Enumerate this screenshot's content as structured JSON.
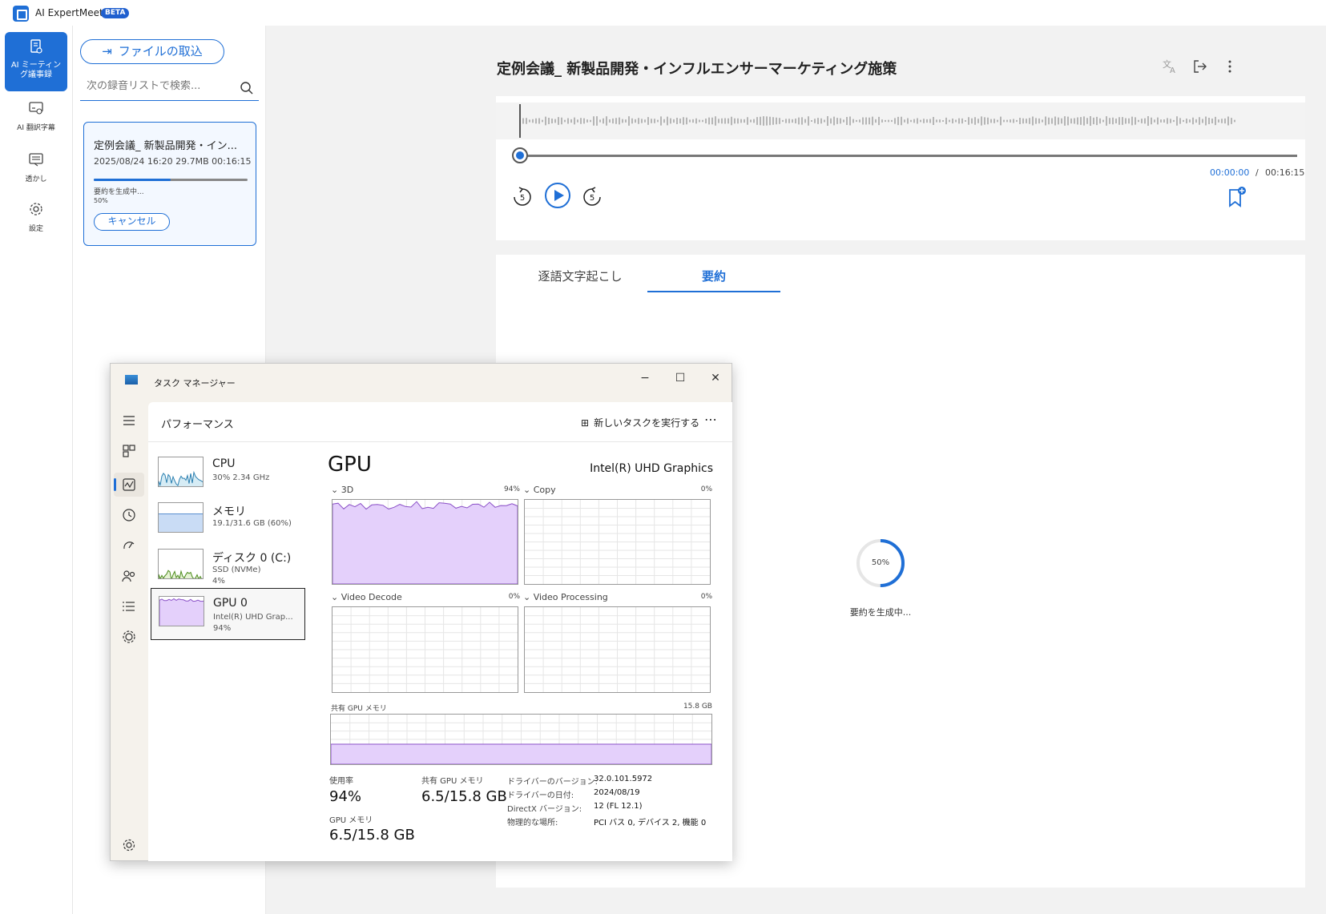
{
  "app": {
    "title": "AI ExpertMeet",
    "badge": "BETA"
  },
  "left_nav": [
    {
      "label": "AI ミーティング議事録",
      "icon": "document-mic-icon",
      "active": true
    },
    {
      "label": "AI 翻訳字幕",
      "icon": "subtitle-icon",
      "active": false
    },
    {
      "label": "透かし",
      "icon": "watermark-icon",
      "active": false
    },
    {
      "label": "設定",
      "icon": "gear-icon",
      "active": false
    }
  ],
  "file_pane": {
    "import_label": "ファイルの取込",
    "search_placeholder": "次の録音リストで検索...",
    "card": {
      "name": "定例会議_ 新製品開発・イン...",
      "meta": "2025/08/24 16:20 29.7MB    00:16:15",
      "status": "要約を生成中...",
      "progress_label": "50%",
      "progress": 0.5,
      "cancel_label": "キャンセル"
    }
  },
  "main": {
    "title": "定例会議_ 新製品開発・インフルエンサーマーケティング施策",
    "time_current": "00:00:00",
    "time_sep": "/",
    "time_total": "00:16:15",
    "rewind_label": "5",
    "forward_label": "5",
    "tabs": [
      {
        "label": "逐語文字起こし",
        "active": false
      },
      {
        "label": "要約",
        "active": true
      }
    ],
    "spinner_pct": "50%",
    "spinner_progress": 0.5,
    "spinner_status": "要約を生成中..."
  },
  "task_manager": {
    "title": "タスク マネージャー",
    "section": "パフォーマンス",
    "new_task": "新しいタスクを実行する",
    "items": [
      {
        "name": "CPU",
        "sub1": "30%  2.34 GHz",
        "sub2": "",
        "sub3": ""
      },
      {
        "name": "メモリ",
        "sub1": "19.1/31.6 GB (60%)",
        "sub2": "",
        "sub3": ""
      },
      {
        "name": "ディスク 0 (C:)",
        "sub1": "SSD (NVMe)",
        "sub2": "4%",
        "sub3": ""
      },
      {
        "name": "GPU 0",
        "sub1": "Intel(R) UHD Grap...",
        "sub2": "94%",
        "sub3": ""
      }
    ],
    "gpu": {
      "heading": "GPU",
      "model": "Intel(R) UHD Graphics",
      "graphs": [
        {
          "label": "3D",
          "pct": "94%"
        },
        {
          "label": "Copy",
          "pct": "0%"
        },
        {
          "label": "Video Decode",
          "pct": "0%"
        },
        {
          "label": "Video Processing",
          "pct": "0%"
        }
      ],
      "shared_mem_label": "共有 GPU メモリ",
      "shared_mem_max": "15.8 GB",
      "usage_label": "使用率",
      "usage_value": "94%",
      "shared_label": "共有 GPU メモリ",
      "shared_value": "6.5/15.8 GB",
      "gpu_mem_label": "GPU メモリ",
      "gpu_mem_value": "6.5/15.8 GB",
      "details": [
        {
          "key": "ドライバーのバージョン:",
          "val": "32.0.101.5972"
        },
        {
          "key": "ドライバーの日付:",
          "val": "2024/08/19"
        },
        {
          "key": "DirectX バージョン:",
          "val": "12 (FL 12.1)"
        },
        {
          "key": "物理的な場所:",
          "val": "PCI バス 0, デバイス 2, 機能 0"
        }
      ]
    }
  },
  "colors": {
    "accent": "#1f6fd6",
    "gpu_fill": "#e4d0fb",
    "gpu_line": "#8a4fc7"
  }
}
